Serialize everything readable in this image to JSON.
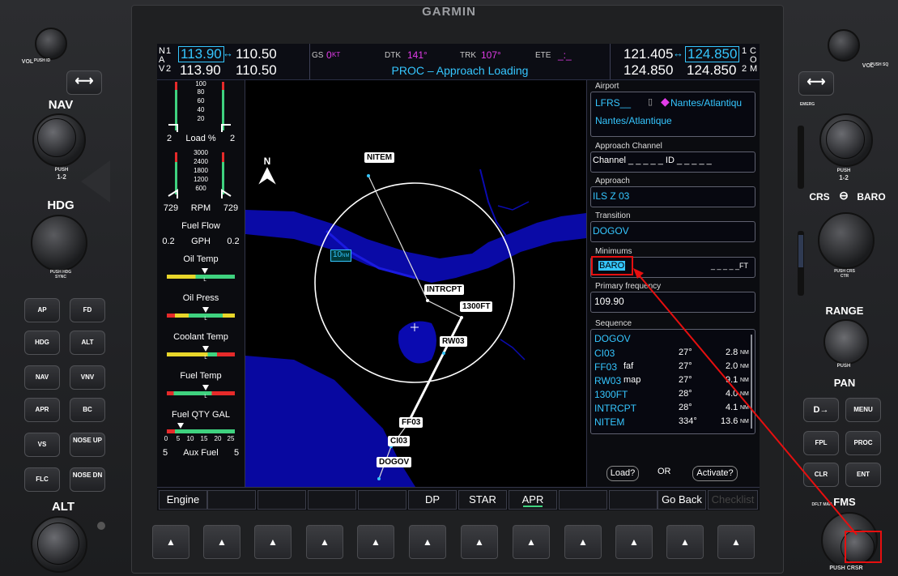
{
  "brand": "GARMIN",
  "nav": {
    "label_n": "N",
    "label_a": "A",
    "label_v": "V",
    "n1": "1",
    "n2": "2",
    "nav1_active": "113.90",
    "nav1_standby": "110.50",
    "nav2_active": "113.90",
    "nav2_standby": "110.50"
  },
  "com": {
    "com1_active": "121.405",
    "com1_standby": "124.850",
    "com2_active": "124.850",
    "com2_standby": "124.850",
    "label_c": "C",
    "label_o": "O",
    "label_m": "M",
    "c1": "1",
    "c2": "2"
  },
  "topcenter": {
    "gs_label": "GS",
    "gs_value": "0",
    "gs_unit": "KT",
    "dtk_label": "DTK",
    "dtk_value": "141°",
    "trk_label": "TRK",
    "trk_value": "107°",
    "ete_label": "ETE",
    "ete_value": "_:_",
    "status": "PROC – Approach Loading"
  },
  "eis": {
    "load_ticks": [
      "100",
      "80",
      "60",
      "40",
      "20"
    ],
    "load_label": "Load %",
    "load_left": "2",
    "load_right": "2",
    "rpm_ticks": [
      "3000",
      "2400",
      "1800",
      "1200",
      "600"
    ],
    "rpm_label": "RPM",
    "rpm_left": "729",
    "rpm_right": "729",
    "fuel_flow_label": "Fuel Flow",
    "gph_label": "GPH",
    "gph_left": "0.2",
    "gph_right": "0.2",
    "oil_temp": "Oil Temp",
    "oil_press": "Oil Press",
    "coolant_temp": "Coolant Temp",
    "fuel_temp": "Fuel Temp",
    "fuel_qty": "Fuel QTY GAL",
    "fuel_scale": [
      "0",
      "5",
      "10",
      "15",
      "20",
      "25"
    ],
    "aux_fuel_label": "Aux Fuel",
    "aux_left": "5",
    "aux_right": "5",
    "ptr_marks": [
      "L",
      "R"
    ]
  },
  "map": {
    "north": "N",
    "range_label": "10",
    "range_unit": "NM",
    "waypoints": {
      "nitem": "NITEM",
      "intrcpt": "INTRCPT",
      "ft1300": "1300FT",
      "rw03": "RW03",
      "ff03": "FF03",
      "ci03": "CI03",
      "dogov": "DOGOV"
    }
  },
  "fpl": {
    "airport_title": "Airport",
    "airport_ident": "LFRS__",
    "airport_name_short": "Nantes/Atlantiqu",
    "airport_name": "Nantes/Atlantique",
    "channel_title": "Approach Channel",
    "channel_text": "Channel _ _ _ _ _ ID _ _ _ _ _",
    "approach_title": "Approach",
    "approach_value": "ILS Z 03",
    "transition_title": "Transition",
    "transition_value": "DOGOV",
    "minimums_title": "Minimums",
    "minimums_type": "BARO",
    "minimums_value": "_ _ _ _ _FT",
    "primary_freq_title": "Primary frequency",
    "primary_freq_value": "109.90",
    "sequence_title": "Sequence",
    "sequence": [
      {
        "name": "DOGOV",
        "suffix": "",
        "crs": "",
        "dist": "",
        "unit": ""
      },
      {
        "name": "CI03",
        "suffix": "",
        "crs": "27°",
        "dist": "2.8",
        "unit": "NM"
      },
      {
        "name": "FF03",
        "suffix": "faf",
        "crs": "27°",
        "dist": "2.0",
        "unit": "NM"
      },
      {
        "name": "RW03",
        "suffix": "map",
        "crs": "27°",
        "dist": "9.1",
        "unit": "NM"
      },
      {
        "name": "1300FT",
        "suffix": "",
        "crs": "28°",
        "dist": "4.0",
        "unit": "NM"
      },
      {
        "name": "INTRCPT",
        "suffix": "",
        "crs": "28°",
        "dist": "4.1",
        "unit": "NM"
      },
      {
        "name": "NITEM",
        "suffix": "",
        "crs": "334°",
        "dist": "13.6",
        "unit": "NM"
      }
    ],
    "load_btn": "Load?",
    "or_text": "OR",
    "activate_btn": "Activate?"
  },
  "softkeys": [
    "Engine",
    "",
    "",
    "",
    "",
    "DP",
    "STAR",
    "APR",
    "",
    "",
    "Go Back",
    "Checklist"
  ],
  "softkey_symbol": "▲",
  "left_panel": {
    "vol_label": "VOL",
    "vol_sub": "PUSH ID",
    "swap": "⟷",
    "nav_label": "NAV",
    "push12": "PUSH",
    "push12b": "1-2",
    "hdg_label": "HDG",
    "hdg_sub": "PUSH HDG SYNC",
    "buttons": [
      [
        "AP",
        "FD"
      ],
      [
        "HDG",
        "ALT"
      ],
      [
        "NAV",
        "VNV"
      ],
      [
        "APR",
        "BC"
      ],
      [
        "VS",
        "NOSE UP"
      ],
      [
        "FLC",
        "NOSE DN"
      ]
    ],
    "alt_label": "ALT"
  },
  "right_panel": {
    "vol_label": "VOL",
    "vol_sub": "PUSH SQ",
    "swap": "⟷",
    "emerg": "EMERG",
    "push": "PUSH",
    "push12": "1-2",
    "crs_label": "CRS",
    "baro_label": "BARO",
    "crs_sub": "PUSH CRS CTR",
    "range_label": "RANGE",
    "push_label": "PUSH",
    "pan_label": "PAN",
    "buttons": [
      [
        "D→",
        "MENU"
      ],
      [
        "FPL",
        "PROC"
      ],
      [
        "CLR",
        "ENT"
      ]
    ],
    "dflt_map": "DFLT MAP",
    "fms_label": "FMS",
    "fms_sub": "PUSH CRSR"
  }
}
